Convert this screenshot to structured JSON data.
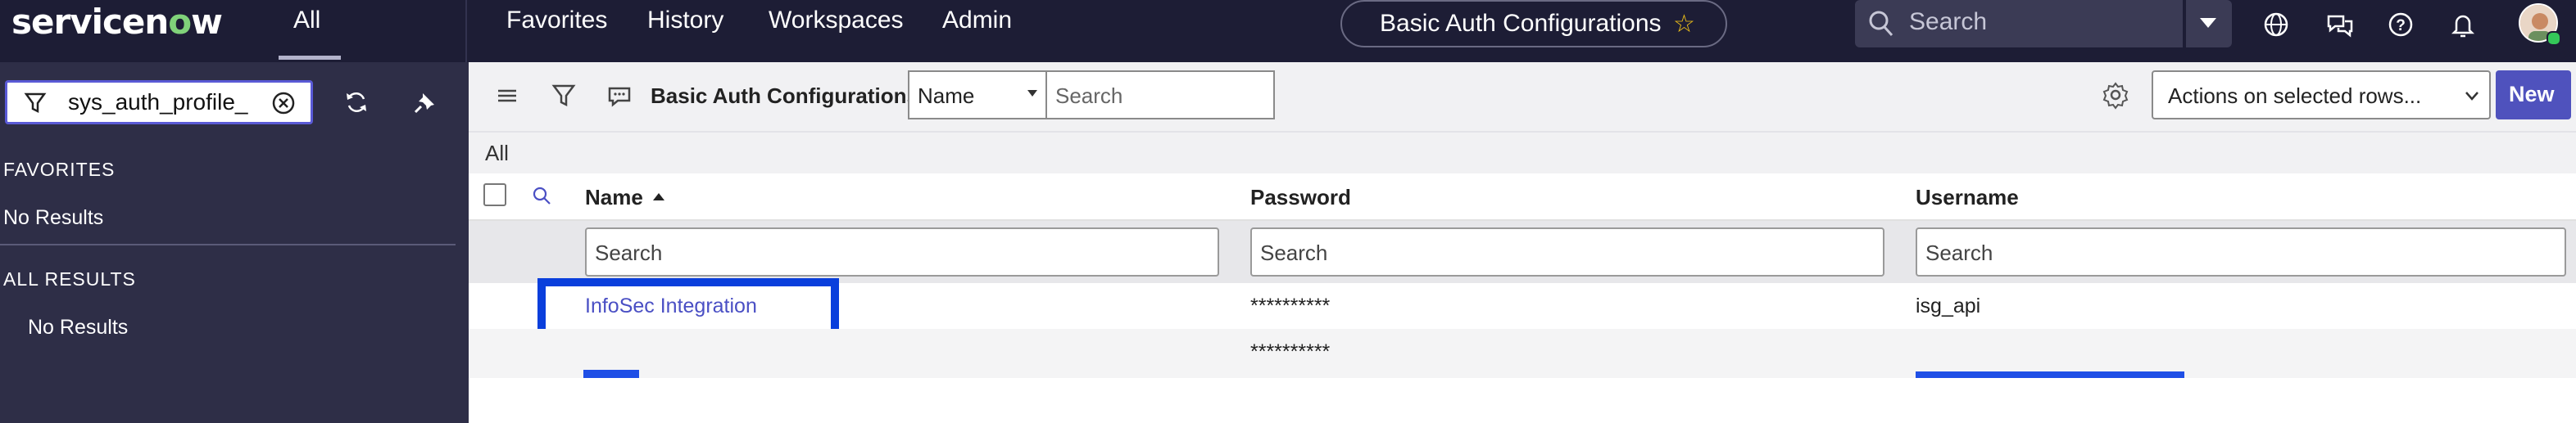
{
  "topnav": {
    "logo": "servicenow",
    "tabs": [
      "All",
      "Favorites",
      "History",
      "Workspaces",
      "Admin"
    ],
    "context_title": "Basic Auth Configurations",
    "search_placeholder": "Search"
  },
  "sidebar": {
    "filter_value": "sys_auth_profile_",
    "favorites_heading": "FAVORITES",
    "favorites_empty": "No Results",
    "all_results_heading": "ALL RESULTS",
    "all_results_empty": "No Results"
  },
  "toolbar": {
    "title": "Basic Auth Configurations",
    "field_select": "Name",
    "search_placeholder": "Search",
    "actions_label": "Actions on selected rows...",
    "new_label": "New"
  },
  "breadcrumb": "All",
  "table": {
    "columns": [
      "Name",
      "Password",
      "Username"
    ],
    "column_search_placeholder": "Search",
    "rows": [
      {
        "name": "InfoSec Integration",
        "password": "**********",
        "username": "isg_api"
      },
      {
        "name": "",
        "password": "**********",
        "username": ""
      }
    ]
  },
  "colors": {
    "topnav_bg": "#1d1d35",
    "sidebar_bg": "#2e2e47",
    "accent": "#4f52bd",
    "highlight": "#0a3fdc"
  }
}
